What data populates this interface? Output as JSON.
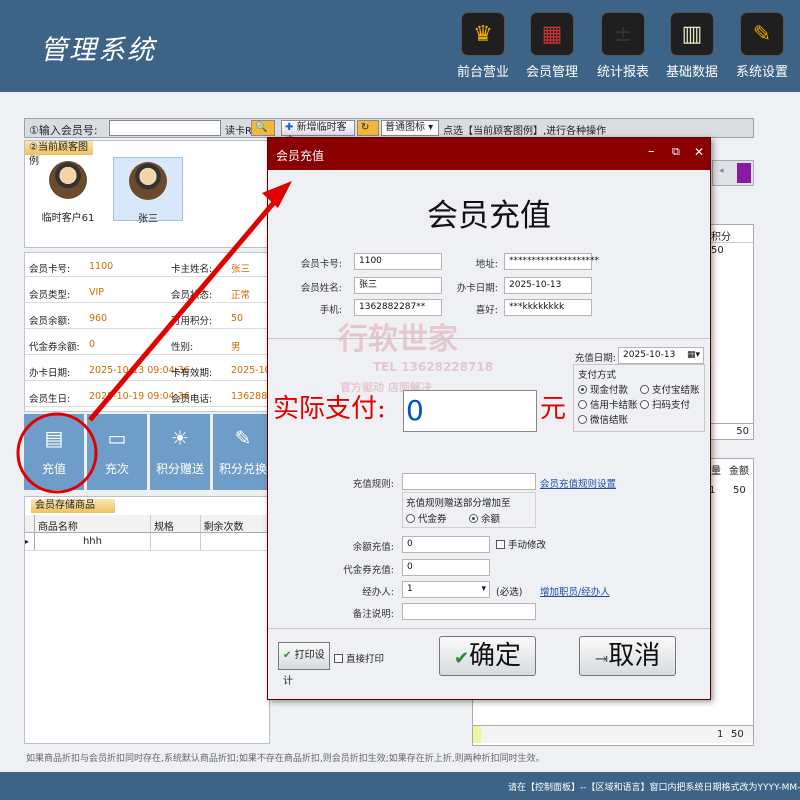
{
  "app": {
    "title": "管理系统"
  },
  "nav": [
    {
      "label": "前台营业",
      "icon": "cashier-icon",
      "color": "#f2b400"
    },
    {
      "label": "会员管理",
      "icon": "member-icon",
      "color": "#c33"
    },
    {
      "label": "统计报表",
      "icon": "calculator-icon",
      "color": "#333"
    },
    {
      "label": "基础数据",
      "icon": "database-icon",
      "color": "#e8e8c8"
    },
    {
      "label": "系统设置",
      "icon": "settings-icon",
      "color": "#f0a000"
    }
  ],
  "toolbar": {
    "member_label": "①输入会员号:",
    "read_card": "读卡R",
    "new_temp": "新增临时客户",
    "view_mode": "普通图标",
    "hint": "点选【当前顾客图例】,进行各种操作"
  },
  "customers": {
    "section": "②当前顾客图例",
    "items": [
      {
        "name": "临时客户61"
      },
      {
        "name": "张三"
      }
    ]
  },
  "info": {
    "rows": [
      {
        "l1": "会员卡号:",
        "v1": "1100",
        "l2": "卡主姓名:",
        "v2": "张三"
      },
      {
        "l1": "会员类型:",
        "v1": "VIP",
        "l2": "会员状态:",
        "v2": "正常"
      },
      {
        "l1": "会员余额:",
        "v1": "960",
        "l2": "可用积分:",
        "v2": "50"
      },
      {
        "l1": "代金券余额:",
        "v1": "0",
        "l2": "性别:",
        "v2": "男"
      },
      {
        "l1": "办卡日期:",
        "v1": "2025-10-13 09:04:36",
        "l2": "卡有效期:",
        "v2": "2025-10-"
      },
      {
        "l1": "会员生日:",
        "v1": "2025-10-19 09:04:36",
        "l2": "会员电话:",
        "v2": "1362882"
      }
    ]
  },
  "actions": [
    {
      "label": "充值",
      "icon": "recharge-icon"
    },
    {
      "label": "充次",
      "icon": "monitor-icon"
    },
    {
      "label": "积分赠送",
      "icon": "sun-icon"
    },
    {
      "label": "积分兑换",
      "icon": "exchange-icon"
    }
  ],
  "goods": {
    "section": "会员存储商品",
    "headers": [
      "商品名称",
      "规格",
      "剩余次数"
    ],
    "rows": [
      [
        "hhh",
        "",
        ""
      ]
    ]
  },
  "right_grid": {
    "h1": "积分",
    "v1": "50",
    "total1": "50",
    "h2": [
      "量",
      "金额"
    ],
    "r2": [
      "1",
      "50"
    ],
    "footer": [
      "1",
      "50"
    ]
  },
  "footnote": "如果商品折扣与会员折扣同时存在,系统默认商品折扣;如果不存在商品折扣,则会员折扣生效;如果存在折上折,则两种折扣同时生效。",
  "status": "请在【控制面板】--【区域和语言】窗口内把系统日期格式改为YYYY-MM-DD",
  "dialog": {
    "title": "会员充值",
    "heading": "会员充值",
    "card_label": "会员卡号:",
    "card": "1100",
    "addr_label": "地址:",
    "addr": "********************",
    "name_label": "会员姓名:",
    "name": "张三",
    "date_label": "办卡日期:",
    "date": "2025-10-13",
    "phone_label": "手机:",
    "phone": "1362882287**",
    "hobby_label": "喜好:",
    "hobby": "***kkkkkkkk",
    "recharge_date_label": "充值日期:",
    "recharge_date": "2025-10-13",
    "pay_label": "实际支付:",
    "pay_value": "0",
    "yuan": "元",
    "pay_method_title": "支付方式",
    "pay_methods": [
      "现金付款",
      "支付宝结账",
      "信用卡结账",
      "扫码支付",
      "微信结账"
    ],
    "rule_label": "充值规则:",
    "rule_link": "会员充值规则设置",
    "bonus_title": "充值规则赠送部分增加至",
    "bonus_opts": [
      "代金券",
      "余额"
    ],
    "balance_label": "余额充值:",
    "balance": "0",
    "manual_label": "手动修改",
    "voucher_label": "代金券充值:",
    "voucher": "0",
    "handler_label": "经办人:",
    "handler": "1",
    "required": "(必选)",
    "add_handler": "增加职员/经办人",
    "note_label": "备注说明:",
    "print_design": "打印设计",
    "direct_print": "直接打印",
    "ok": "确定",
    "cancel": "取消",
    "watermark": {
      "big": "行软世家",
      "tel": "TEL  13628228718",
      "small": "官方驱动  店面解决"
    }
  }
}
